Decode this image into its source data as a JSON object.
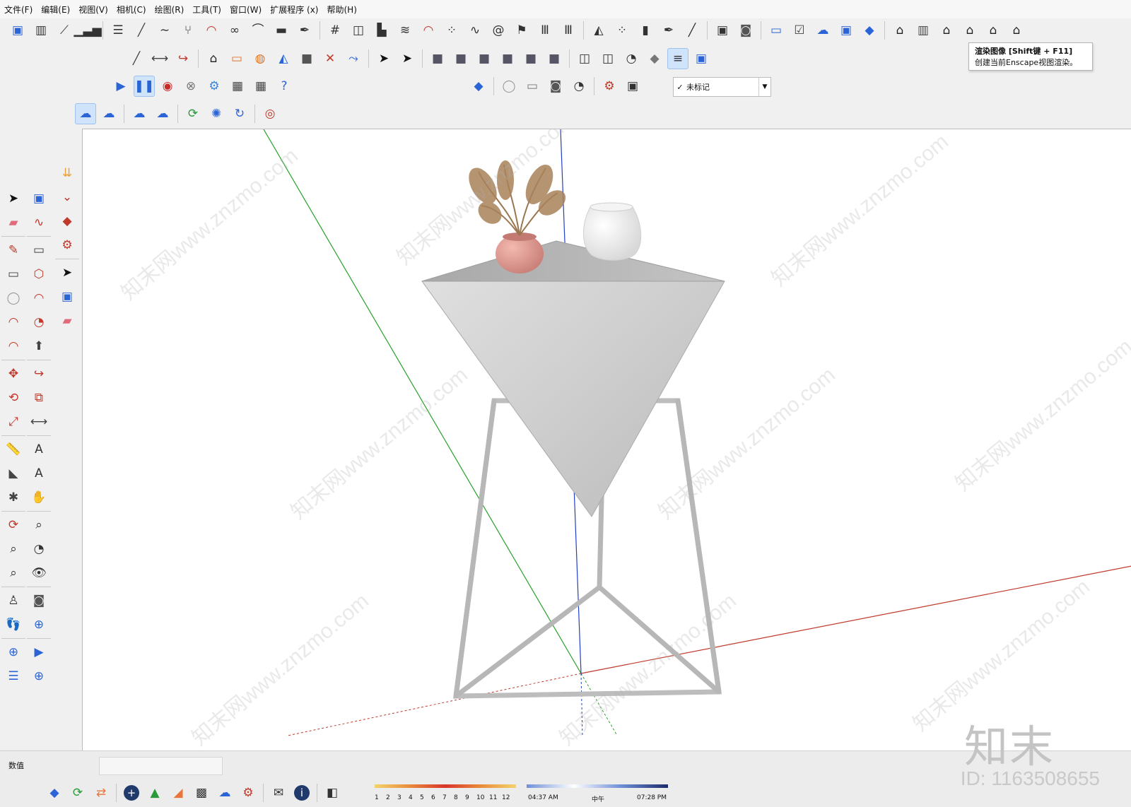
{
  "menu": [
    "文件(F)",
    "编辑(E)",
    "视图(V)",
    "相机(C)",
    "绘图(R)",
    "工具(T)",
    "窗口(W)",
    "扩展程序 (x)",
    "帮助(H)"
  ],
  "tooltip": {
    "title": "渲染图像 [Shift键 + F11]",
    "desc": "创建当前Enscape视图渲染。"
  },
  "tag_dropdown": {
    "check": "✓",
    "value": "未标记"
  },
  "status": {
    "measurements_label": "数值"
  },
  "sun": {
    "months": [
      "1",
      "2",
      "3",
      "4",
      "5",
      "6",
      "7",
      "8",
      "9",
      "10",
      "11",
      "12"
    ],
    "time_start": "04:37 AM",
    "time_noon": "中午",
    "time_end": "07:28 PM"
  },
  "watermark": {
    "logo": "知末",
    "id": "ID: 1163508655",
    "repeat": "知末网www.znzmo.com"
  },
  "colors": {
    "axis_red": "#c0392b",
    "axis_green": "#27a127",
    "axis_blue": "#2340c4",
    "accent": "#cfe3fb"
  },
  "icons": {
    "row1": [
      "sandbox-icon",
      "ruler-icon",
      "stairs-icon",
      "bar-chart-icon",
      "layer-tool-icon",
      "line-icon",
      "curve-icon",
      "fork-icon",
      "arch-icon",
      "loop-icon",
      "pipe-icon",
      "slab-icon",
      "pen-icon",
      "grid-icon",
      "cube-pattern-icon",
      "building-icon",
      "stack-icon",
      "arc-icon",
      "dots-icon",
      "wave-icon",
      "spiral-icon",
      "flag-icon",
      "bars-icon",
      "columns-icon",
      "mirror-icon",
      "dot-grid-icon",
      "book-icon",
      "arrow-pen-icon",
      "brush-icon",
      "mod-icon",
      "camera-lens-icon",
      "folder-open-icon",
      "checkbox-icon",
      "cloud-upload-icon",
      "box-export-icon",
      "enscape-logo-icon",
      "house-icon",
      "door-icon",
      "home-icon",
      "roof-icon",
      "house-outline-icon",
      "canopy-icon"
    ],
    "row2": [
      "line-draw-icon",
      "dimension-icon",
      "follow-icon",
      "roof-pitch-icon",
      "frame-icon",
      "cylinder-icon",
      "triangle-icon",
      "arrow-tool-icon",
      "cross-icon",
      "sweep-icon",
      "select-box-icon",
      "select-rect-icon",
      "solid-cube-icon",
      "solid-union-icon",
      "solid-subtract-icon",
      "solid-intersect-icon",
      "solid-trim-icon",
      "solid-split-icon",
      "wire-cube-icon",
      "iso-cube-icon",
      "top-view-icon",
      "shaded-icon",
      "layered-icon",
      "blue-box-icon"
    ],
    "row3": [
      "play-icon",
      "pause-icon",
      "record-icon",
      "stop-icon",
      "settings-icon",
      "film-icon",
      "film-grey-icon",
      "help-icon"
    ],
    "row3b": [
      "enscape-p-icon",
      "circle-icon",
      "video-icon",
      "camera-icon",
      "view-icon",
      "gear-outline-icon",
      "package-icon"
    ],
    "row4": [
      "cloud-link-icon",
      "cloud-node-icon",
      "cloud-check-icon",
      "cloud-list-icon",
      "sync-frame-icon",
      "network-icon",
      "refresh-clock-icon",
      "chrome-icon"
    ],
    "left_col1": [
      "select-arrow-icon",
      "eraser-icon",
      "pencil-icon",
      "rectangle-icon",
      "circle-draw-icon",
      "arc-draw-icon",
      "arc-2pt-icon",
      "move-icon",
      "rotate-icon",
      "scale-icon",
      "tape-measure-icon",
      "protractor-icon",
      "axes-icon",
      "orbit-icon",
      "zoom-icon",
      "zoom-extents-icon",
      "walk-icon",
      "footprints-icon",
      "section-icon",
      "layers-icon"
    ],
    "left_col2": [
      "component-icon",
      "freehand-icon",
      "rotated-rect-icon",
      "polygon-icon",
      "arc-3pt-icon",
      "pie-icon",
      "push-pull-icon",
      "follow-me-icon",
      "offset-icon",
      "dimension-label-icon",
      "text-icon",
      "3d-text-icon",
      "pan-hand-icon",
      "zoom-window-icon",
      "previous-view-icon",
      "look-around-icon",
      "position-camera-icon",
      "section-plane-icon",
      "section-display-icon",
      "section-fill-icon"
    ],
    "left_col3": [
      "download-arrow-icon",
      "collapse-icon",
      "paint-bucket-icon",
      "gear-red-icon",
      "select-arrow-2-icon",
      "component-2-icon",
      "eraser-2-icon"
    ],
    "bottom": [
      "enscape-e-icon",
      "sync-icon",
      "arrows-icon",
      "add-icon",
      "tree-icon",
      "terrain-icon",
      "checker-icon",
      "cloud-icon",
      "gears-icon",
      "mail-icon",
      "info-icon",
      "shadow-icon"
    ]
  }
}
